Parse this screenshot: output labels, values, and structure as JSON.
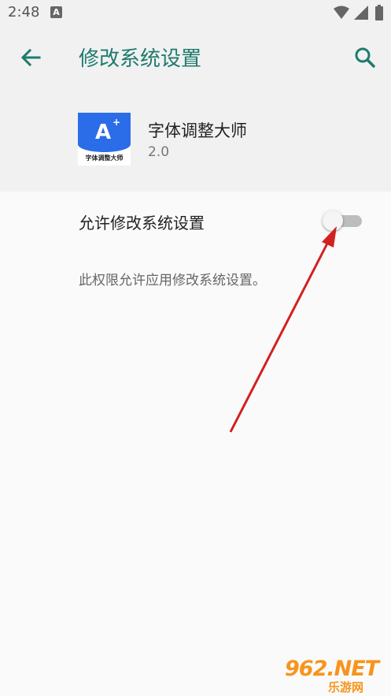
{
  "status_bar": {
    "time": "2:48",
    "notification_icon": "A"
  },
  "header": {
    "title": "修改系统设置",
    "back_icon": "arrow-left-icon",
    "search_icon": "search-icon"
  },
  "app": {
    "name": "字体调整大师",
    "version": "2.0",
    "icon_letter": "A",
    "icon_plus": "+",
    "icon_caption": "字体调整大师",
    "icon_color": "#2b6de8"
  },
  "permission": {
    "label": "允许修改系统设置",
    "toggle_on": false,
    "description": "此权限允许应用修改系统设置。"
  },
  "watermark": {
    "main": "962.NET",
    "sub": "乐游网"
  },
  "colors": {
    "accent": "#1f7a6e",
    "annotation_arrow": "#d32020",
    "watermark": "#f7941d"
  }
}
